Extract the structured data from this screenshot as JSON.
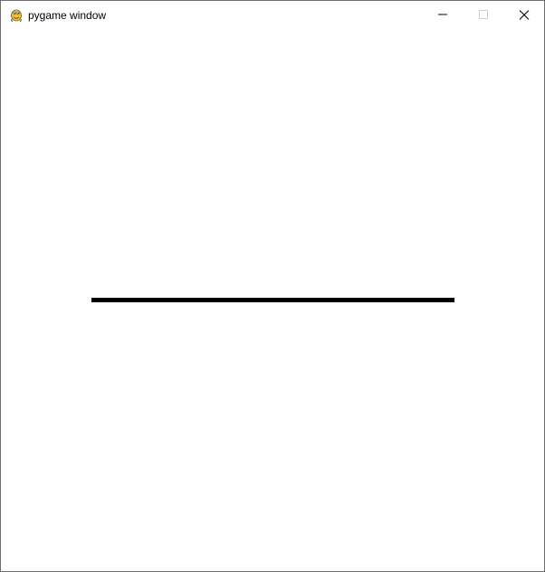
{
  "window": {
    "title": "pygame window",
    "icon": "pygame-snake-icon",
    "controls": {
      "minimize_icon": "minimize-icon",
      "maximize_icon": "maximize-icon",
      "maximize_state": "disabled",
      "close_icon": "close-icon"
    }
  },
  "canvas": {
    "background_color": "#ffffff",
    "line_color": "#000000"
  }
}
